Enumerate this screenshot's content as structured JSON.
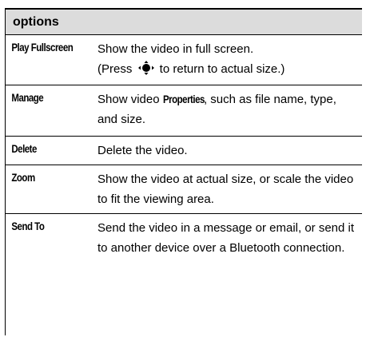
{
  "table": {
    "header": "options",
    "rows": [
      {
        "name": "Play Fullscreen",
        "desc_line1": "Show the video in full screen.",
        "desc_line2_before": "(Press ",
        "desc_line2_after": " to return to actual size.)",
        "icon": "navigation-key-icon"
      },
      {
        "name": "Manage",
        "desc_before": "Show video ",
        "desc_term": "Properties",
        "desc_after": ", such as file name, type, and size."
      },
      {
        "name": "Delete",
        "desc": "Delete the video."
      },
      {
        "name": "Zoom",
        "desc": "Show the video at actual size, or scale the video to fit the viewing area."
      },
      {
        "name": "Send To",
        "desc": "Send the video in a message or email, or send it to another device over a Bluetooth connection."
      }
    ]
  }
}
